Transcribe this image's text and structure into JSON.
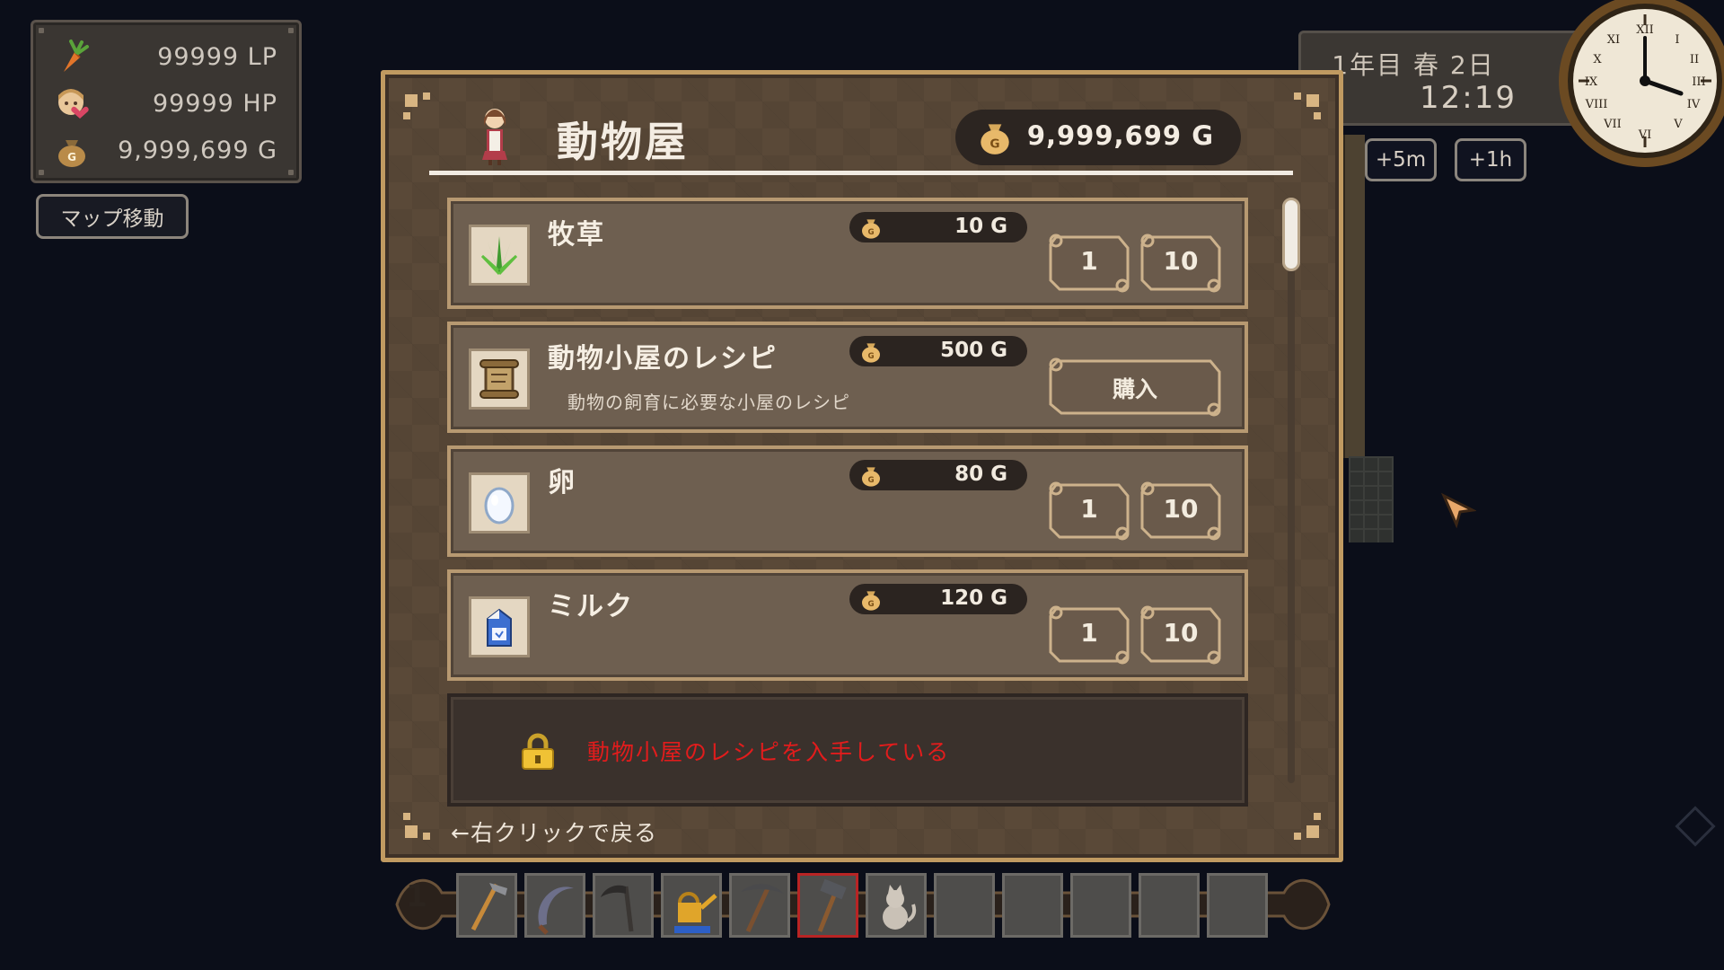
{
  "status": {
    "lp": "99999 LP",
    "hp": "99999 HP",
    "gold": "9,999,699 G",
    "icons": [
      "carrot-icon",
      "face-heart-icon",
      "gold-bag-icon"
    ]
  },
  "map_button": "マップ移動",
  "datetime": {
    "date": "1年目 春 2日",
    "time": "12:19",
    "plus5m": "+5m",
    "plus1h": "+1h"
  },
  "shop": {
    "title": "動物屋",
    "money": "9,999,699 G",
    "items": [
      {
        "name": "牧草",
        "price": "10 G",
        "icon": "grass-icon",
        "qty": [
          "1",
          "10"
        ]
      },
      {
        "name": "動物小屋のレシピ",
        "price": "500 G",
        "icon": "scroll-icon",
        "desc": "動物の飼育に必要な小屋のレシピ",
        "buy": "購入"
      },
      {
        "name": "卵",
        "price": "80 G",
        "icon": "egg-icon",
        "qty": [
          "1",
          "10"
        ]
      },
      {
        "name": "ミルク",
        "price": "120 G",
        "icon": "milk-carton-icon",
        "qty": [
          "1",
          "10"
        ]
      }
    ],
    "locked_message": "動物小屋のレシピを入手している",
    "back_hint": "←右クリックで戻る"
  },
  "hotbar": {
    "page": "1",
    "slots": [
      "hoe-icon",
      "sickle-icon",
      "scythe-icon",
      "watering-can-icon",
      "pickaxe-icon",
      "hammer-icon",
      "cat-icon",
      "",
      "",
      "",
      "",
      ""
    ],
    "selected_index": 5
  },
  "colors": {
    "accent_red": "#e21c1c",
    "panel_border": "#c09a61"
  }
}
